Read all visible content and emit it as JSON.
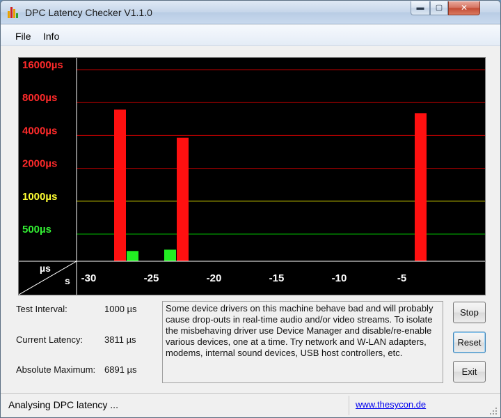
{
  "window": {
    "title": "DPC Latency Checker V1.1.0",
    "controls": {
      "minimize": "▬",
      "maximize": "▢",
      "close": "✕"
    }
  },
  "menu": {
    "file": "File",
    "info": "Info"
  },
  "chart_data": {
    "type": "bar",
    "y_scale": "log2",
    "y_tick_labels": [
      {
        "value": 16000,
        "label": "16000µs",
        "color": "#ff2a2a"
      },
      {
        "value": 8000,
        "label": "8000µs",
        "color": "#ff2a2a"
      },
      {
        "value": 4000,
        "label": "4000µs",
        "color": "#ff2a2a"
      },
      {
        "value": 2000,
        "label": "2000µs",
        "color": "#ff2a2a"
      },
      {
        "value": 1000,
        "label": "1000µs",
        "color": "#ffff33"
      },
      {
        "value": 500,
        "label": "500µs",
        "color": "#33ee33"
      }
    ],
    "x_tick_labels": [
      {
        "value": -30,
        "label": "-30"
      },
      {
        "value": -25,
        "label": "-25"
      },
      {
        "value": -20,
        "label": "-20"
      },
      {
        "value": -15,
        "label": "-15"
      },
      {
        "value": -10,
        "label": "-10"
      },
      {
        "value": -5,
        "label": "-5"
      }
    ],
    "axis_corner": {
      "y_unit": "µs",
      "x_unit": "s"
    },
    "xlim": [
      -33,
      0
    ],
    "values_us": [
      130,
      130,
      130,
      6891,
      350,
      130,
      120,
      360,
      3811,
      130,
      130,
      120,
      130,
      130,
      130,
      130,
      120,
      130,
      130,
      130,
      130,
      125,
      130,
      120,
      120,
      130,
      130,
      6400,
      130,
      130,
      130,
      190
    ],
    "threshold_us": 1000,
    "colors": {
      "ok": "#22ee22",
      "bad": "#ff1010",
      "grid_red": "#c00000",
      "grid_yellow": "#d8d800",
      "grid_green": "#00c000",
      "axis": "#ffffff"
    }
  },
  "stats": {
    "test_interval_label": "Test Interval:",
    "test_interval_value": "1000 µs",
    "current_latency_label": "Current Latency:",
    "current_latency_value": "3811 µs",
    "absolute_max_label": "Absolute Maximum:",
    "absolute_max_value": "6891 µs"
  },
  "message": "Some device drivers on this machine behave bad and will probably cause drop-outs in real-time audio and/or video streams. To isolate the misbehaving driver use Device Manager and disable/re-enable various devices, one at a time. Try network and W-LAN adapters, modems, internal sound devices, USB host controllers, etc.",
  "buttons": {
    "stop": "Stop",
    "reset": "Reset",
    "exit": "Exit"
  },
  "status": {
    "text": "Analysing DPC latency ...",
    "link": "www.thesycon.de"
  }
}
